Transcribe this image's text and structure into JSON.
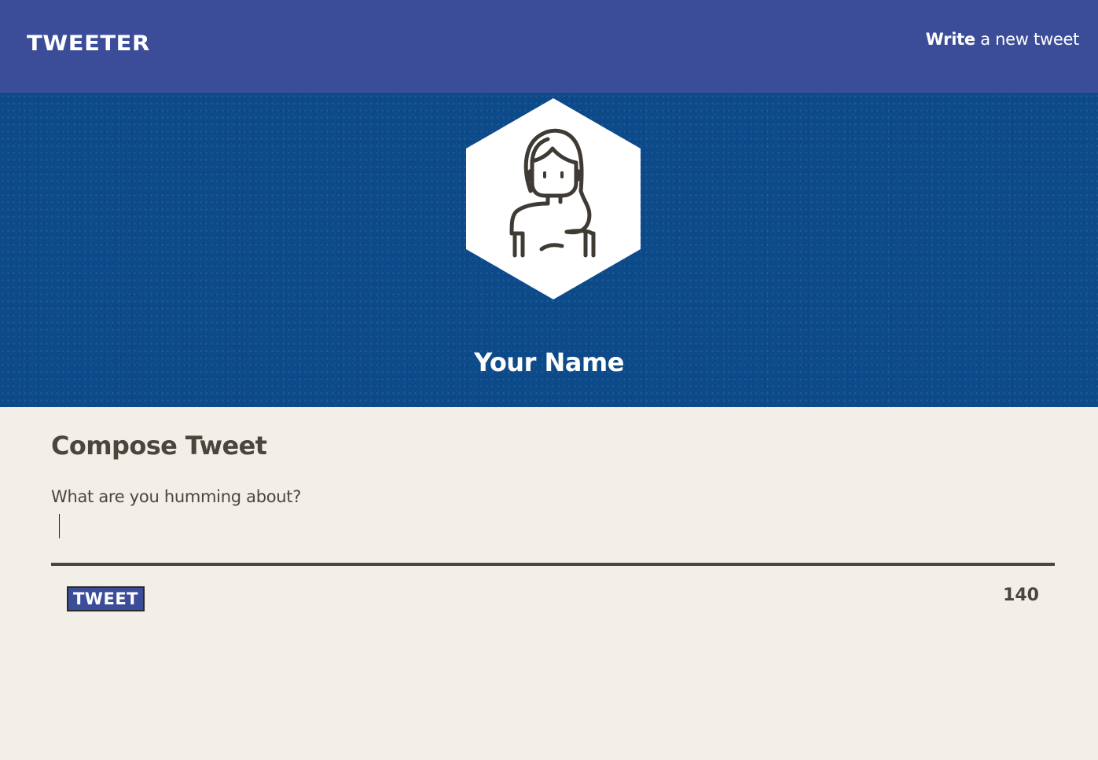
{
  "nav": {
    "logo": "TWEETER",
    "write_bold": "Write",
    "write_rest": " a new tweet"
  },
  "profile": {
    "name": "Your Name",
    "avatar_icon": "user-avatar-icon"
  },
  "compose": {
    "title": "Compose Tweet",
    "prompt": "What are you humming about?",
    "input_value": "",
    "button_label": "TWEET",
    "counter": "140"
  },
  "colors": {
    "nav_bg": "#3b4d98",
    "hero_bg": "#0c4a8a",
    "page_bg": "#f2efe8",
    "text": "#4a463e"
  }
}
